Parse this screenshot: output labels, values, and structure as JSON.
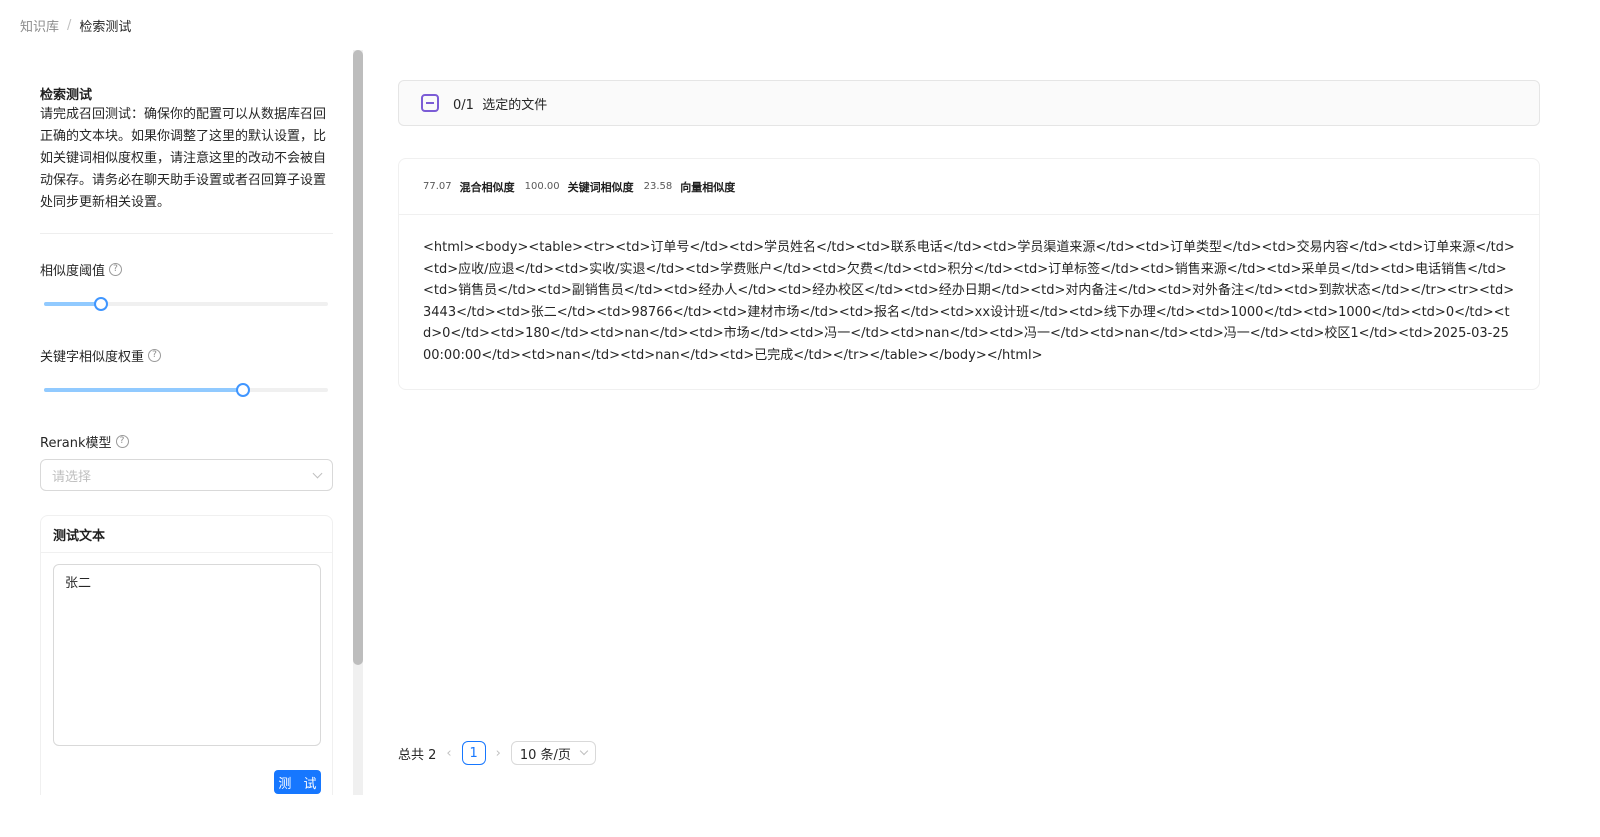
{
  "breadcrumb": {
    "parent": "知识库",
    "separator": "/",
    "current": "检索测试"
  },
  "intro": {
    "title": "检索测试",
    "description": "请完成召回测试：确保你的配置可以从数据库召回正确的文本块。如果你调整了这里的默认设置，比如关键词相似度权重，请注意这里的改动不会被自动保存。请务必在聊天助手设置或者召回算子设置处同步更新相关设置。"
  },
  "settings": {
    "similarity_threshold": {
      "label": "相似度阈值",
      "value_fraction": 0.2
    },
    "keyword_weight": {
      "label": "关键字相似度权重",
      "value_fraction": 0.7
    },
    "rerank": {
      "label": "Rerank模型",
      "placeholder": "请选择"
    }
  },
  "test": {
    "title": "测试文本",
    "query": "张二",
    "button_label": "测 试"
  },
  "files": {
    "count": "0/1",
    "label": "选定的文件"
  },
  "result": {
    "hybrid_score": "77.07",
    "hybrid_label": "混合相似度",
    "keyword_score": "100.00",
    "keyword_label": "关键词相似度",
    "vector_score": "23.58",
    "vector_label": "向量相似度",
    "content": "<html><body><table><tr><td>订单号</td><td>学员姓名</td><td>联系电话</td><td>学员渠道来源</td><td>订单类型</td><td>交易内容</td><td>订单来源</td><td>应收/应退</td><td>实收/实退</td><td>学费账户</td><td>欠费</td><td>积分</td><td>订单标签</td><td>销售来源</td><td>采单员</td><td>电话销售</td><td>销售员</td><td>副销售员</td><td>经办人</td><td>经办校区</td><td>经办日期</td><td>对内备注</td><td>对外备注</td><td>到款状态</td></tr><tr><td>3443</td><td>张二</td><td>98766</td><td>建材市场</td><td>报名</td><td>xx设计班</td><td>线下办理</td><td>1000</td><td>1000</td><td>0</td><td>0</td><td>180</td><td>nan</td><td>市场</td><td>冯一</td><td>nan</td><td>冯一</td><td>nan</td><td>冯一</td><td>校区1</td><td>2025-03-25 00:00:00</td><td>nan</td><td>nan</td><td>已完成</td></tr></table></body></html>"
  },
  "pagination": {
    "total": "总共 2",
    "current": "1",
    "page_size": "10 条/页"
  },
  "colors": {
    "primary": "#1677ff",
    "slider_track": "#91caff",
    "file_icon": "#7b5cd6"
  }
}
